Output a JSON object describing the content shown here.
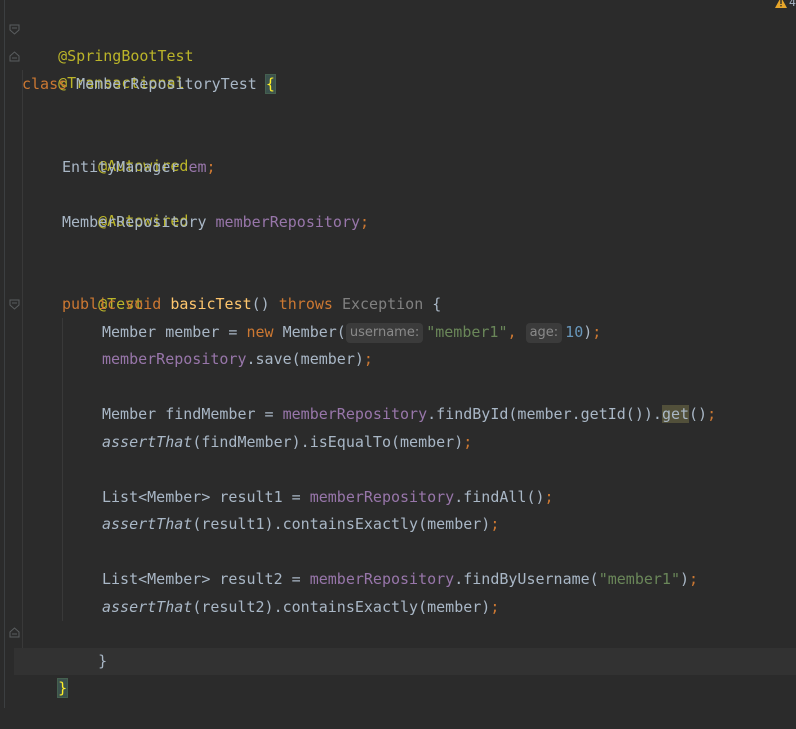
{
  "status": {
    "warning_count": "4"
  },
  "code": {
    "l1": {
      "ann": "@SpringBootTest"
    },
    "l2": {
      "ann": "@Transactional"
    },
    "l3": {
      "kw": "class",
      "name": " MemberRepositoryTest ",
      "brace": "{"
    },
    "l5": {
      "ann": "@Autowired"
    },
    "l6": {
      "type": "EntityManager ",
      "field": "em",
      "semi": ";"
    },
    "l7": {
      "ann": "@Autowired"
    },
    "l8": {
      "type": "MemberRepository ",
      "field": "memberRepository",
      "semi": ";"
    },
    "l10": {
      "ann": "@Test"
    },
    "l11": {
      "kw1": "public",
      "sp1": " ",
      "kw2": "void",
      "sp2": " ",
      "fn": "basicTest",
      "paren": "() ",
      "kw3": "throws",
      "sp3": " ",
      "exc": "Exception",
      "tail": " {"
    },
    "l12": {
      "pre": "Member member = ",
      "kw": "new",
      "call": " Member(",
      "hint1": "username:",
      "str1": "\"member1\"",
      "comma1": ",",
      "hint2": "age:",
      "num": "10",
      "close": ")",
      "semi": ";"
    },
    "l13": {
      "field": "memberRepository",
      "call": ".save(member)",
      "semi": ";"
    },
    "l15": {
      "pre": "Member findMember = ",
      "field": "memberRepository",
      "call": ".findById(member.getId()).",
      "get": "get",
      "close": "()",
      "semi": ";"
    },
    "l16": {
      "st": "assertThat",
      "call": "(findMember).isEqualTo(member)",
      "semi": ";"
    },
    "l18": {
      "pre": "List<Member> result1 = ",
      "field": "memberRepository",
      "call": ".findAll()",
      "semi": ";"
    },
    "l19": {
      "st": "assertThat",
      "call": "(result1).containsExactly(member)",
      "semi": ";"
    },
    "l21": {
      "pre": "List<Member> result2 = ",
      "field": "memberRepository",
      "call": ".findByUsername(",
      "str": "\"member1\"",
      "close": ")",
      "semi": ";"
    },
    "l22": {
      "st": "assertThat",
      "call": "(result2).containsExactly(member)",
      "semi": ";"
    },
    "l23": {
      "brace": "}"
    },
    "l24": {
      "brace": "}"
    }
  }
}
